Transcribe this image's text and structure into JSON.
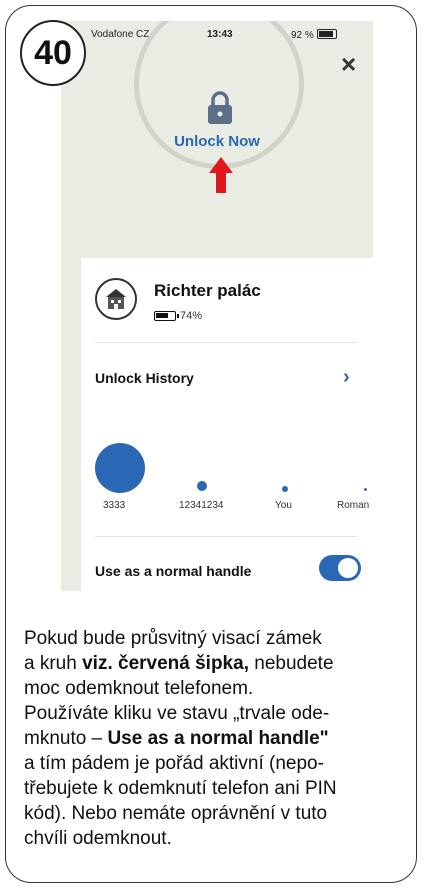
{
  "step_number": "40",
  "status_bar": {
    "carrier": "Vodafone CZ",
    "time": "13:43",
    "right": "92 %"
  },
  "unlock": {
    "label": "Unlock Now"
  },
  "device": {
    "name": "Richter palác",
    "battery": "74%",
    "battery_level": 0.74
  },
  "history": {
    "label": "Unlock History",
    "users": [
      {
        "name": "3333"
      },
      {
        "name": "12341234"
      },
      {
        "name": "You"
      },
      {
        "name": "Roman"
      }
    ]
  },
  "handle": {
    "label": "Use as a normal handle",
    "enabled": true
  },
  "description": {
    "line1": "Pokud bude průsvitný visací zámek",
    "line2_pre": "a kruh ",
    "line2_bold": "viz. červená šipka,",
    "line2_post": " nebudete",
    "line3": "moc odemknout telefonem.",
    "line4": "Používáte kliku ve stavu „trvale ode-",
    "line5_pre": "mknuto – ",
    "line5_bold": "Use as a normal handle\"",
    "line6": "a tím pádem je pořád aktivní (nepo-",
    "line7": "třebujete k odemknutí telefon ani PIN",
    "line8": "kód). Nebo nemáte oprávnění v tuto",
    "line9": "chvíli odemknout."
  },
  "colors": {
    "accent": "#2a67b5",
    "arrow": "#e0181e",
    "phone_bg": "#e9ece3"
  }
}
